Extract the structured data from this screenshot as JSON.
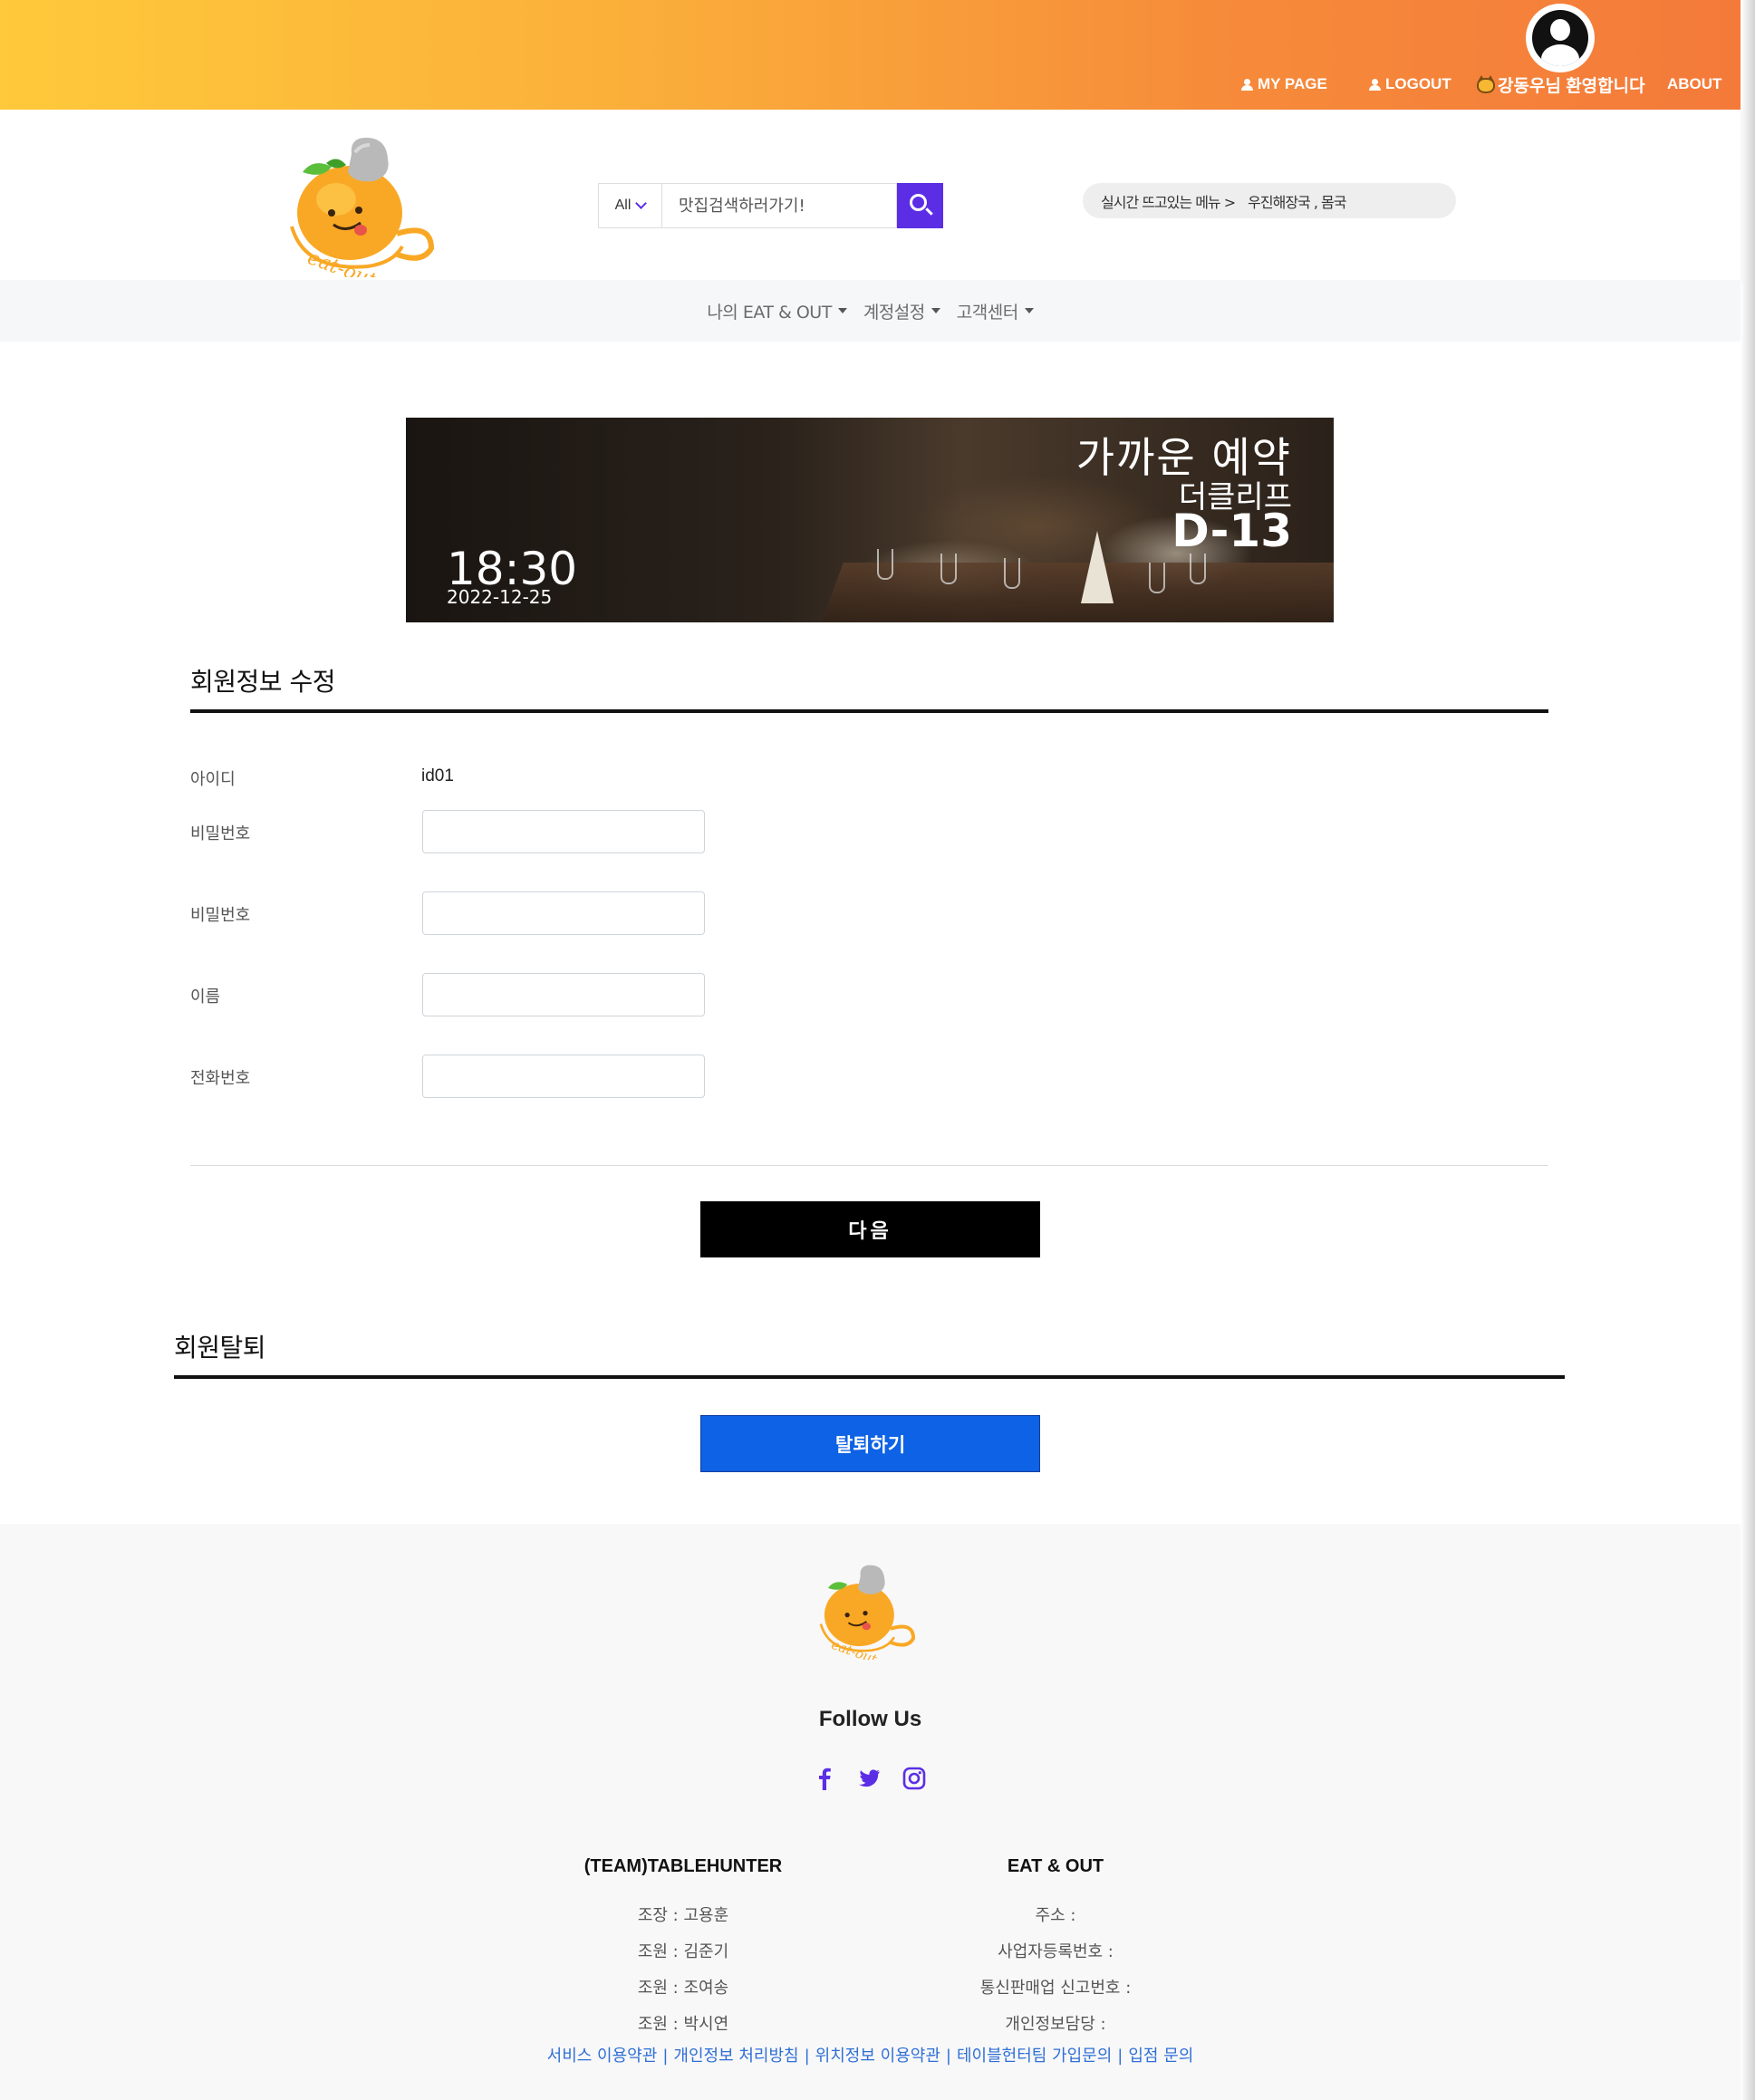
{
  "topbar": {
    "my_page": "MY PAGE",
    "logout": "LOGOUT",
    "welcome": "강동우님 환영합니다",
    "about": "ABOUT",
    "gradient": [
      "#ffc93a",
      "#f47a3a"
    ]
  },
  "search": {
    "category": "All",
    "placeholder": "맛집검색하러가기!",
    "button_icon": "search-icon",
    "accent": "#5b2ee6"
  },
  "realtime": {
    "label": "실시간 뜨고있는 메뉴 >",
    "value": "우진해장국 , 몸국"
  },
  "subnav": {
    "items": [
      {
        "label": "나의 EAT & OUT"
      },
      {
        "label": "계정설정"
      },
      {
        "label": "고객센터"
      }
    ]
  },
  "banner": {
    "title": "가까운 예약",
    "shop": "더클리프",
    "dday": "D-13",
    "time": "18:30",
    "date": "2022-12-25"
  },
  "form": {
    "title": "회원정보 수정",
    "id_label": "아이디",
    "id_value": "id01",
    "password_label": "비밀번호",
    "password_confirm_label": "비밀번호",
    "name_label": "이름",
    "phone_label": "전화번호",
    "next_button": "다음"
  },
  "withdraw": {
    "title": "회원탈퇴",
    "button": "탈퇴하기",
    "button_color": "#0d62e5"
  },
  "footer": {
    "follow": "Follow Us",
    "social_icons": [
      "facebook-icon",
      "twitter-icon",
      "instagram-icon"
    ],
    "team": {
      "title": "(TEAM)TABLEHUNTER",
      "lines": [
        "조장 : 고용훈",
        "조원 : 김준기",
        "조원 : 조여송",
        "조원 : 박시연"
      ]
    },
    "company": {
      "title": "EAT & OUT",
      "lines": [
        "주소 :",
        "사업자등록번호 :",
        "통신판매업 신고번호 :",
        "개인정보담당 :"
      ]
    },
    "links": [
      "서비스 이용약관",
      "개인정보 처리방침",
      "위치정보 이용약관",
      "테이블헌터팀 가입문의",
      "입점 문의"
    ]
  }
}
